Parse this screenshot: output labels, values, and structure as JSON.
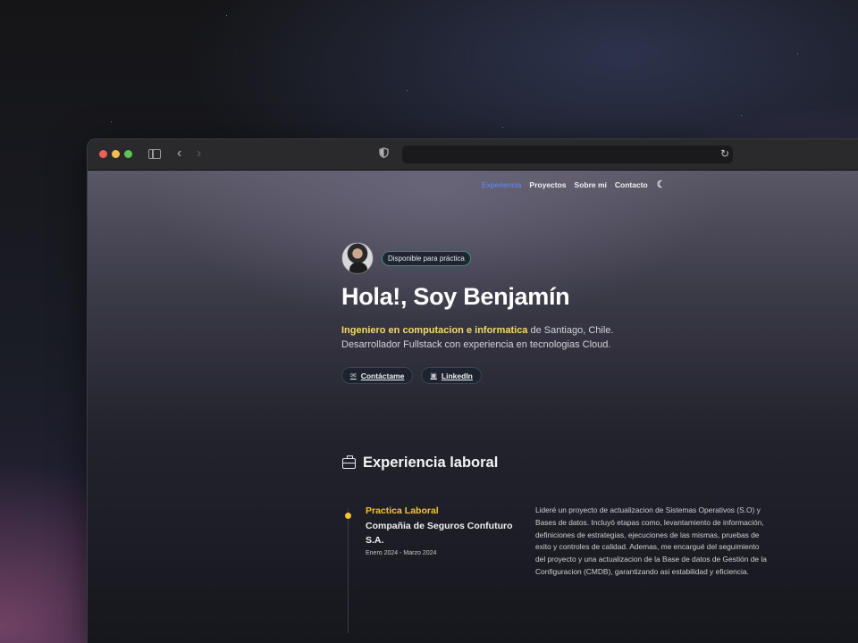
{
  "nav": {
    "items": [
      "Experiencia",
      "Proyectos",
      "Sobre mí",
      "Contacto"
    ],
    "theme_icon": "moon-icon"
  },
  "hero": {
    "badge": "Disponible para práctica",
    "title": "Hola!, Soy Benjamín",
    "highlight": "Ingeniero en computacion e informatica",
    "desc_rest": " de Santiago, Chile.",
    "desc_line2": "Desarrollador Fullstack con experiencia en tecnologias Cloud.",
    "contact_button": "Contáctame",
    "linkedin_button": "LinkedIn"
  },
  "experience": {
    "section_title": "Experiencia laboral",
    "role": "Practica Laboral",
    "company": "Compañia de Seguros Confuturo S.A.",
    "date": "Enero 2024 - Marzo 2024",
    "description": "Lideré un proyecto de actualizacion de Sistemas Operativos (S.O) y Bases de datos. Incluyó etapas como, levantamiento de información, definiciones de estrategias, ejecuciones de las mismas, pruebas de exito y controles de calidad. Ademas, me encargué del seguimiento del proyecto y una actualizacion de la Base de datos de Gestión de la Configuracion (CMDB), garantizando asi estabilidad y eficiencia."
  },
  "colors": {
    "accent_nav": "#5b8cff",
    "highlight": "#f5d96b",
    "timeline": "#f5c535"
  }
}
